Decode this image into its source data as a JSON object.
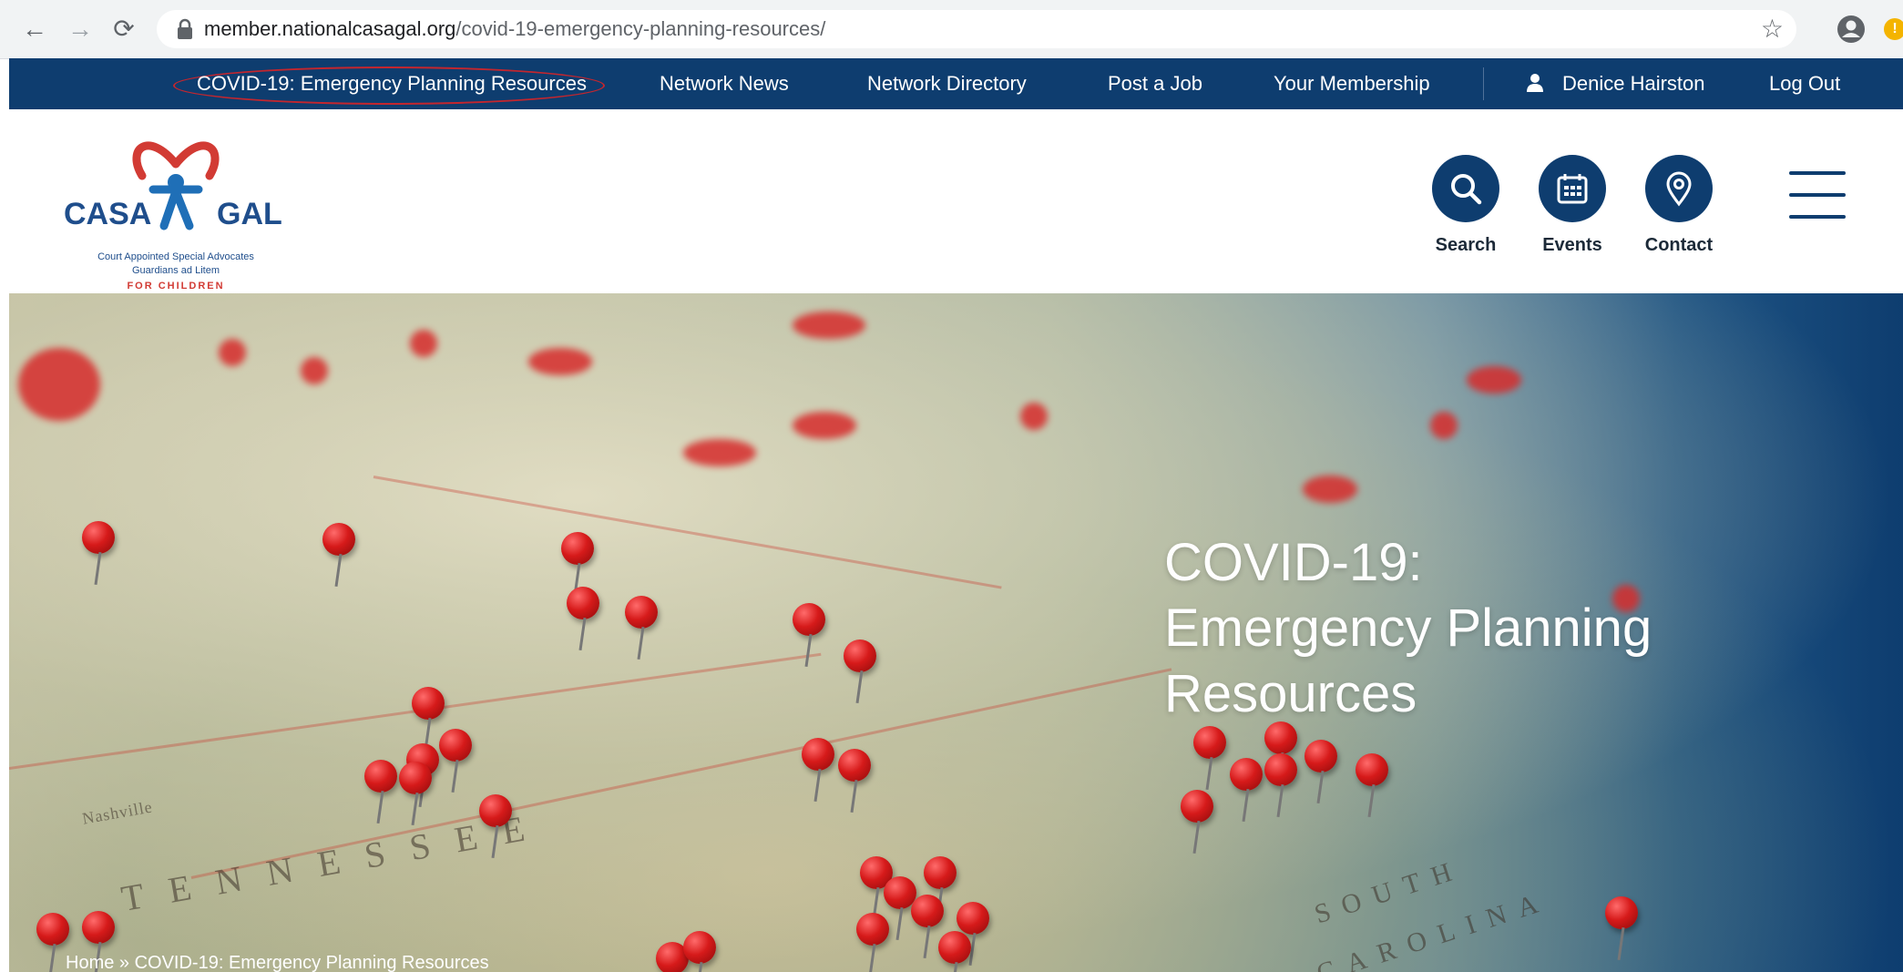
{
  "browser": {
    "url_domain": "member.nationalcasagal.org",
    "url_path": "/covid-19-emergency-planning-resources/",
    "ext_badge": "!"
  },
  "topnav": {
    "items": [
      {
        "label": "COVID-19: Emergency Planning Resources"
      },
      {
        "label": "Network News"
      },
      {
        "label": "Network Directory"
      },
      {
        "label": "Post a Job"
      },
      {
        "label": "Your Membership"
      }
    ],
    "user_name": "Denice Hairston",
    "logout": "Log Out"
  },
  "logo": {
    "left_word": "CASA",
    "right_word": "GAL",
    "caption1": "Court Appointed Special Advocates",
    "caption2": "Guardians ad Litem",
    "caption3": "FOR CHILDREN"
  },
  "quick_links": [
    {
      "label": "Search",
      "icon": "search-icon"
    },
    {
      "label": "Events",
      "icon": "calendar-icon"
    },
    {
      "label": "Contact",
      "icon": "location-pin-icon"
    }
  ],
  "hero": {
    "title_line1": "COVID-19:",
    "title_line2": "Emergency Planning",
    "title_line3": "Resources",
    "breadcrumb": "Home » COVID-19: Emergency Planning Resources",
    "map_labels": [
      "TENNESSEE",
      "SOUTH",
      "CAROLINA",
      "Nashville"
    ]
  },
  "colors": {
    "navy": "#0e3d6f",
    "logo_red": "#d23b34",
    "annotation_red": "#c4262e"
  }
}
